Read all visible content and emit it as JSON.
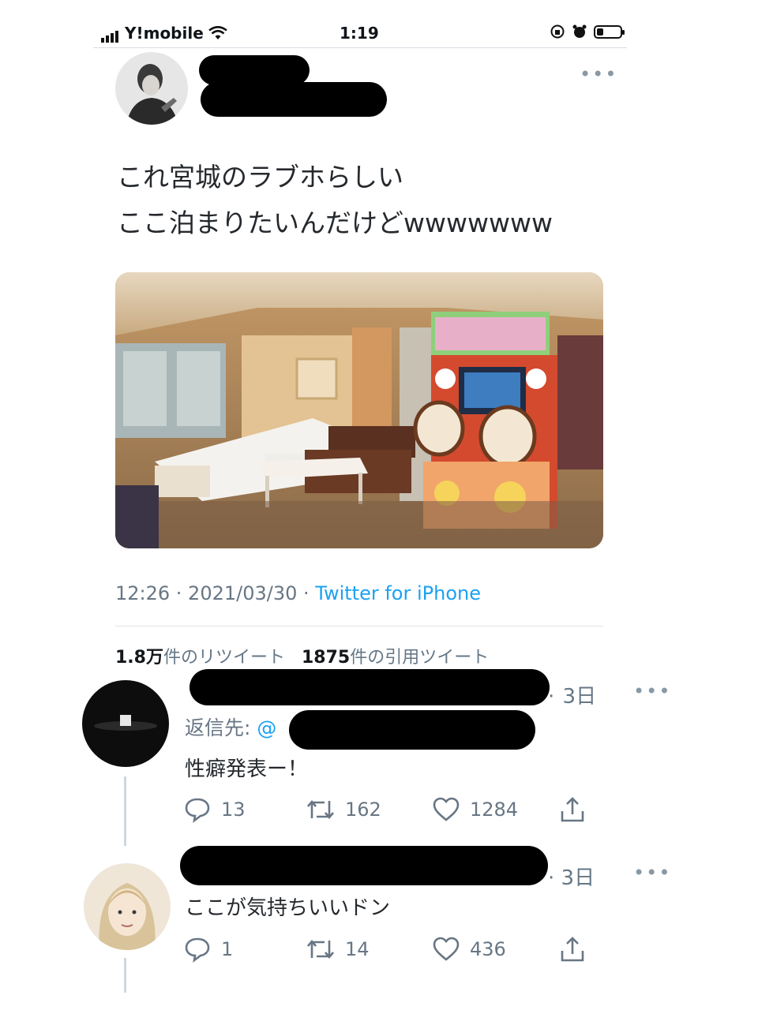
{
  "status_bar": {
    "carrier": "Y!mobile",
    "time": "1:19"
  },
  "tweet": {
    "text": "これ宮城のラブホらしい\nここ泊まりたいんだけどwwwwwww",
    "timestamp": "12:26 · 2021/03/30 · ",
    "source": "Twitter for iPhone",
    "retweets_count": "1.8万",
    "retweets_label": "件のリツイート",
    "quotes_count": "1875",
    "quotes_label": "件の引用ツイート"
  },
  "replies": [
    {
      "age": "3日",
      "reply_to_label": "返信先: ",
      "reply_to_handle": "@",
      "text": "性癖発表ー！",
      "reply_count": "13",
      "retweet_count": "162",
      "like_count": "1284"
    },
    {
      "age": "3日",
      "text": "ここが気持ちいいドン",
      "reply_count": "1",
      "retweet_count": "14",
      "like_count": "436"
    }
  ],
  "icons": {
    "signal": "signal-bars-icon",
    "wifi": "wifi-icon",
    "battery": "battery-icon",
    "more": "more-options-icon",
    "reply": "reply-icon",
    "retweet": "retweet-icon",
    "like": "like-icon",
    "share": "share-icon"
  },
  "colors": {
    "link": "#1da1f2",
    "muted": "#687684",
    "text": "#25292d"
  }
}
